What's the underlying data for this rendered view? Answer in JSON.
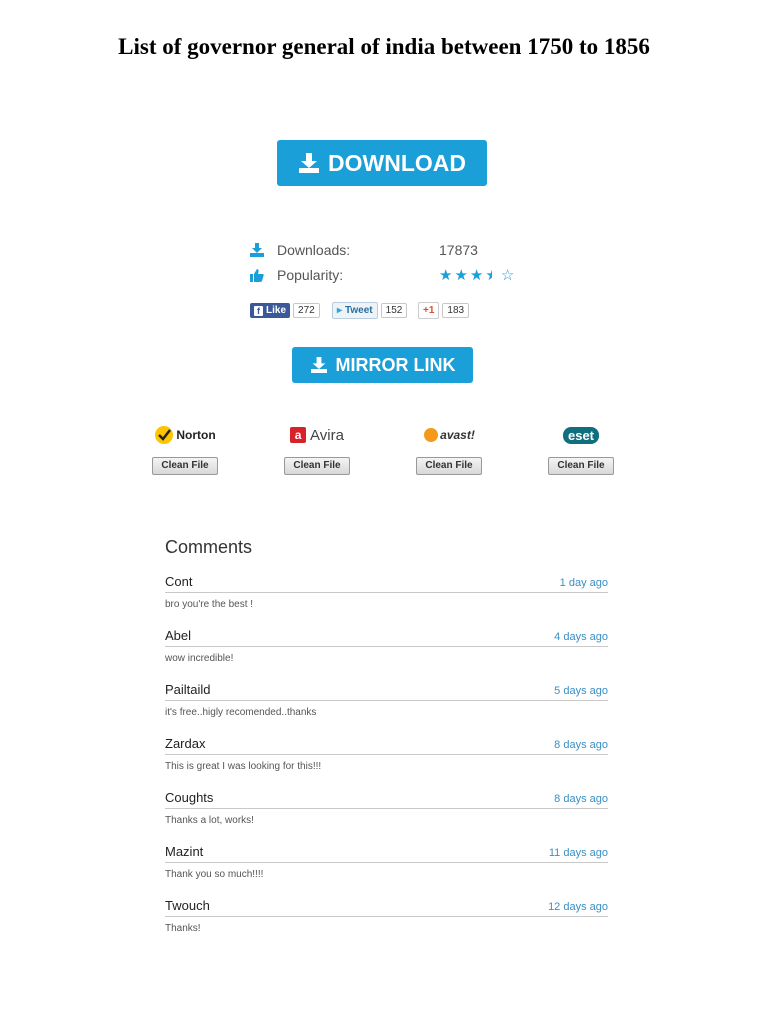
{
  "page": {
    "title": "List of governor general of india between 1750 to 1856"
  },
  "download_button": {
    "label": "DOWNLOAD",
    "icon": "download-icon",
    "color": "#1a9fd9"
  },
  "stats": {
    "downloads_label": "Downloads:",
    "downloads_value": "17873",
    "popularity_label": "Popularity:",
    "popularity_rating": 3.5,
    "rating_max": 5
  },
  "social": {
    "facebook": {
      "label": "Like",
      "count": "272"
    },
    "twitter": {
      "label": "Tweet",
      "count": "152"
    },
    "googleplus": {
      "label": "+1",
      "count": "183"
    }
  },
  "mirror_button": {
    "label": "MIRROR LINK",
    "icon": "download-icon"
  },
  "antivirus": [
    {
      "name": "Norton",
      "badge": "Clean File"
    },
    {
      "name": "Avira",
      "badge": "Clean File"
    },
    {
      "name": "avast!",
      "badge": "Clean File"
    },
    {
      "name": "eset",
      "badge": "Clean File"
    }
  ],
  "comments": {
    "title": "Comments",
    "items": [
      {
        "name": "Cont",
        "time": "1 day ago",
        "text": "bro you're the best !"
      },
      {
        "name": "Abel",
        "time": "4 days ago",
        "text": "wow incredible!"
      },
      {
        "name": "Pailtaild",
        "time": "5 days ago",
        "text": "it's free..higly recomended..thanks"
      },
      {
        "name": "Zardax",
        "time": "8 days ago",
        "text": "This is great I was looking for this!!!"
      },
      {
        "name": "Coughts",
        "time": "8 days ago",
        "text": "Thanks a lot, works!"
      },
      {
        "name": "Mazint",
        "time": "11 days ago",
        "text": "Thank you so much!!!!"
      },
      {
        "name": "Twouch",
        "time": "12 days ago",
        "text": "Thanks!"
      }
    ]
  }
}
